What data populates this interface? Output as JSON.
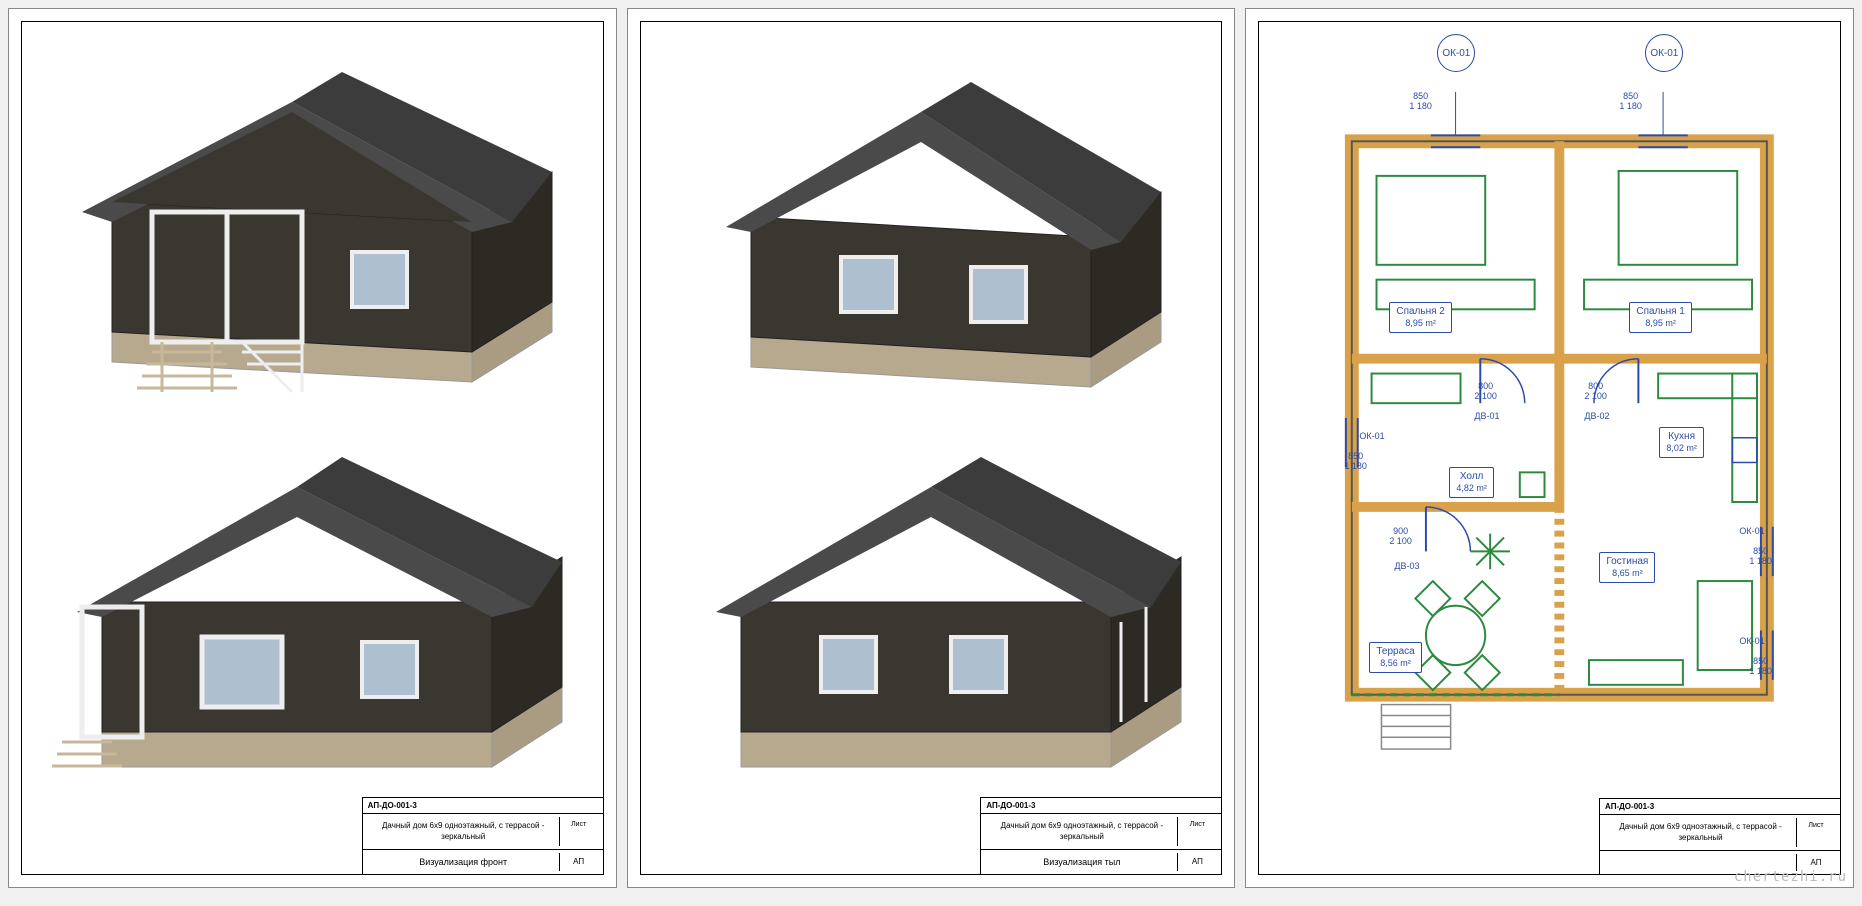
{
  "sheets": [
    {
      "code": "АП-ДО-001-3",
      "desc": "Дачный дом 6х9 одноэтажный, с террасой - зеркальный",
      "view": "Визуализация фронт",
      "leaf_header": "Лист",
      "leaf_value": "АП"
    },
    {
      "code": "АП-ДО-001-3",
      "desc": "Дачный дом 6х9 одноэтажный, с террасой - зеркальный",
      "view": "Визуализация тыл",
      "leaf_header": "Лист",
      "leaf_value": "АП"
    },
    {
      "code": "АП-ДО-001-3",
      "desc": "Дачный дом 6х9 одноэтажный, с террасой - зеркальный",
      "view": "",
      "leaf_header": "Лист",
      "leaf_value": "АП"
    }
  ],
  "plan": {
    "rooms": {
      "bedroom2": {
        "name": "Спальня 2",
        "area": "8,95 m²"
      },
      "bedroom1": {
        "name": "Спальня 1",
        "area": "8,95 m²"
      },
      "hall": {
        "name": "Холл",
        "area": "4,82 m²"
      },
      "kitchen": {
        "name": "Кухня",
        "area": "8,02 m²"
      },
      "living": {
        "name": "Гостиная",
        "area": "8,65 m²"
      },
      "terrace": {
        "name": "Терраса",
        "area": "8,56 m²"
      }
    },
    "openings": {
      "window": "ОК-01",
      "door1": "ДВ-01",
      "door2": "ДВ-02",
      "door3": "ДВ-03"
    },
    "dims": {
      "win_w": "850",
      "win_h": "1 180",
      "door_w": "800",
      "door_h": "2 100",
      "door3_w": "900",
      "door3_h": "2 100"
    }
  },
  "watermark": "chertezhi.ru"
}
